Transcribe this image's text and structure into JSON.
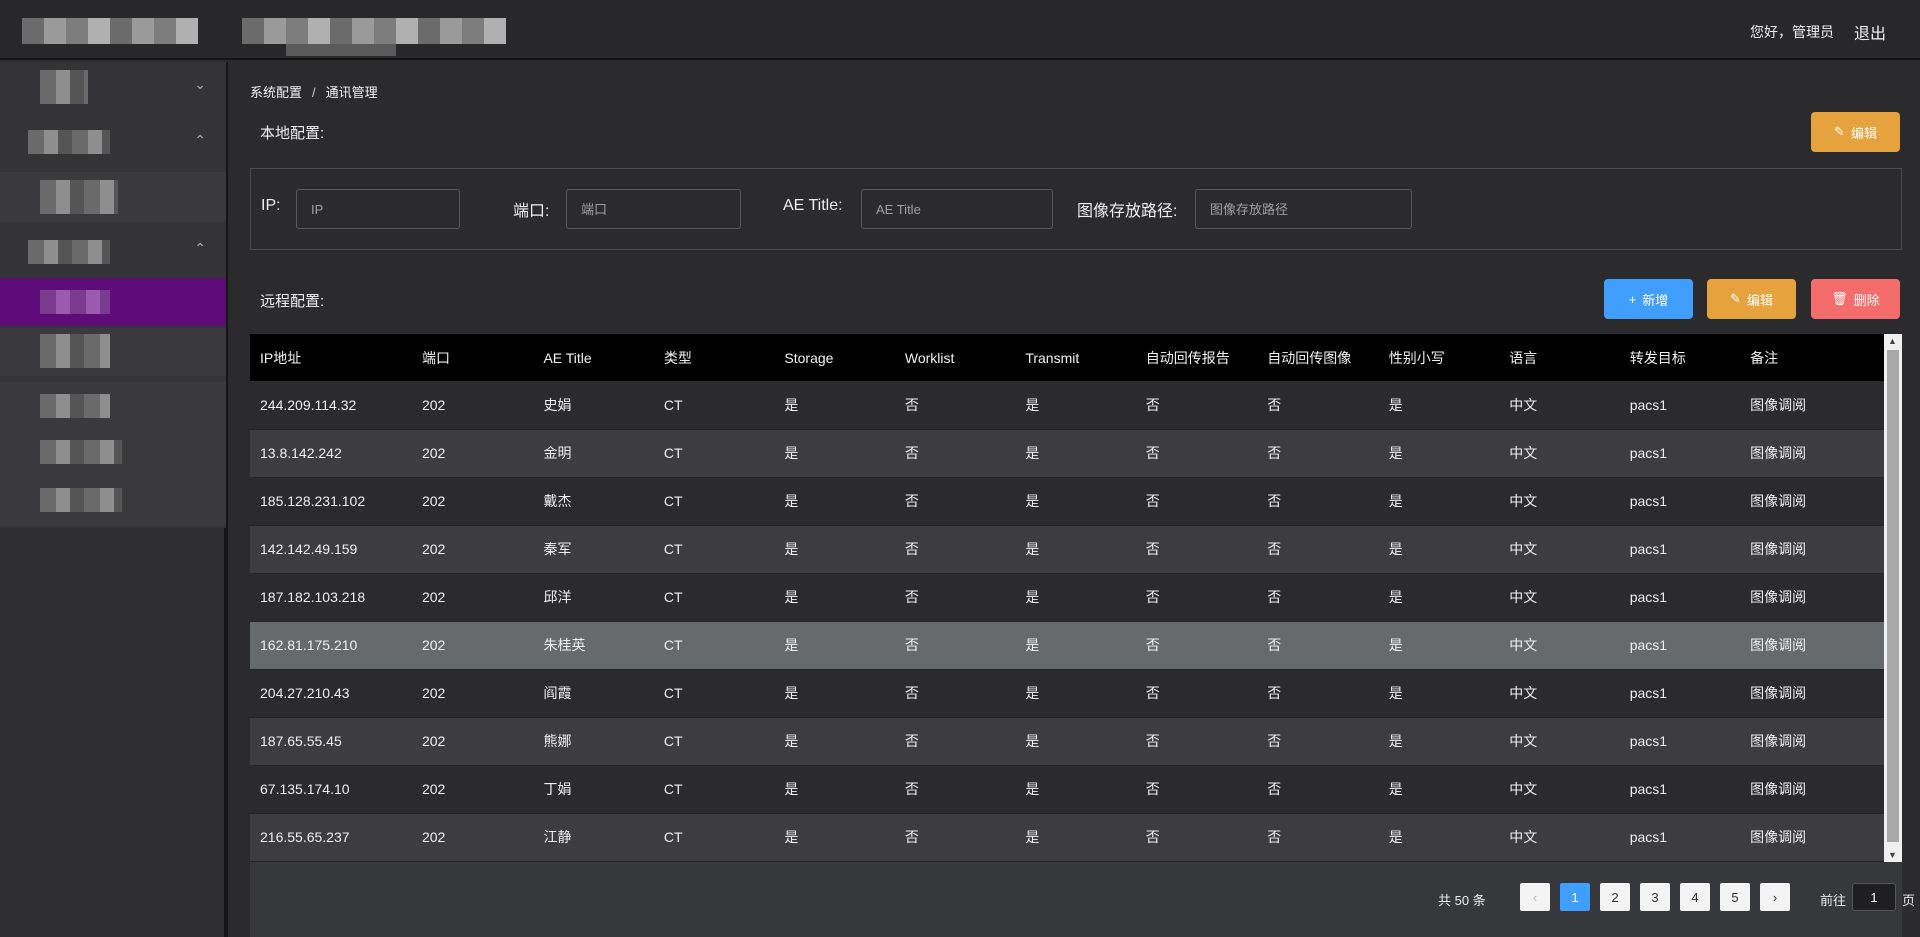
{
  "header": {
    "greeting": "您好，管理员",
    "logout": "退出"
  },
  "sidebar": {
    "chevrons": [
      "⌄",
      "⌃",
      "⌃"
    ]
  },
  "breadcrumb": {
    "parent": "系统配置",
    "separator": "/",
    "current": "通讯管理"
  },
  "local": {
    "title": "本地配置:",
    "edit_label": "编辑",
    "fields": [
      {
        "label": "IP:",
        "placeholder": "IP"
      },
      {
        "label": "端口:",
        "placeholder": "端口"
      },
      {
        "label": "AE Title:",
        "placeholder": "AE Title"
      },
      {
        "label": "图像存放路径:",
        "placeholder": "图像存放路径"
      }
    ]
  },
  "remote": {
    "title": "远程配置:",
    "add_label": "新增",
    "edit_label": "编辑",
    "delete_label": "删除"
  },
  "table": {
    "columns": [
      "IP地址",
      "端口",
      "AE Title",
      "类型",
      "Storage",
      "Worklist",
      "Transmit",
      "自动回传报告",
      "自动回传图像",
      "性别小写",
      "语言",
      "转发目标",
      "备注"
    ],
    "rows": [
      [
        "244.209.114.32",
        "202",
        "史娟",
        "CT",
        "是",
        "否",
        "是",
        "否",
        "否",
        "是",
        "中文",
        "pacs1",
        "图像调阅"
      ],
      [
        "13.8.142.242",
        "202",
        "金明",
        "CT",
        "是",
        "否",
        "是",
        "否",
        "否",
        "是",
        "中文",
        "pacs1",
        "图像调阅"
      ],
      [
        "185.128.231.102",
        "202",
        "戴杰",
        "CT",
        "是",
        "否",
        "是",
        "否",
        "否",
        "是",
        "中文",
        "pacs1",
        "图像调阅"
      ],
      [
        "142.142.49.159",
        "202",
        "秦军",
        "CT",
        "是",
        "否",
        "是",
        "否",
        "否",
        "是",
        "中文",
        "pacs1",
        "图像调阅"
      ],
      [
        "187.182.103.218",
        "202",
        "邱洋",
        "CT",
        "是",
        "否",
        "是",
        "否",
        "否",
        "是",
        "中文",
        "pacs1",
        "图像调阅"
      ],
      [
        "162.81.175.210",
        "202",
        "朱桂英",
        "CT",
        "是",
        "否",
        "是",
        "否",
        "否",
        "是",
        "中文",
        "pacs1",
        "图像调阅"
      ],
      [
        "204.27.210.43",
        "202",
        "阎霞",
        "CT",
        "是",
        "否",
        "是",
        "否",
        "否",
        "是",
        "中文",
        "pacs1",
        "图像调阅"
      ],
      [
        "187.65.55.45",
        "202",
        "熊娜",
        "CT",
        "是",
        "否",
        "是",
        "否",
        "否",
        "是",
        "中文",
        "pacs1",
        "图像调阅"
      ],
      [
        "67.135.174.10",
        "202",
        "丁娟",
        "CT",
        "是",
        "否",
        "是",
        "否",
        "否",
        "是",
        "中文",
        "pacs1",
        "图像调阅"
      ],
      [
        "216.55.65.237",
        "202",
        "江静",
        "CT",
        "是",
        "否",
        "是",
        "否",
        "否",
        "是",
        "中文",
        "pacs1",
        "图像调阅"
      ]
    ],
    "highlighted_row": 5
  },
  "pagination": {
    "total": "共 50 条",
    "prev": "‹",
    "next": "›",
    "pages": [
      "1",
      "2",
      "3",
      "4",
      "5"
    ],
    "current_page": "1",
    "goto_prefix": "前往",
    "goto_value": "1",
    "goto_suffix": "页"
  },
  "colors": {
    "accent_active_menu": "#5e0c78",
    "warning": "#e6a23c",
    "primary": "#409eff",
    "danger": "#f56c6c"
  }
}
